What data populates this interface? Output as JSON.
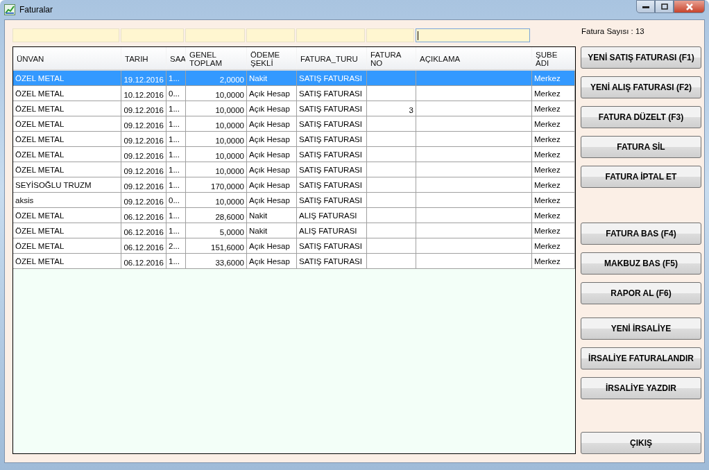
{
  "window": {
    "title": "Faturalar"
  },
  "filters": [
    {
      "focused": false
    },
    {
      "focused": false
    },
    {
      "focused": false
    },
    {
      "focused": false
    },
    {
      "focused": false
    },
    {
      "focused": false
    },
    {
      "focused": true
    }
  ],
  "invoice_count": "Fatura Sayısı : 13",
  "table": {
    "columns": [
      {
        "label": "ÜNVAN"
      },
      {
        "label": "TARIH"
      },
      {
        "label": "SAA"
      },
      {
        "label": "GENEL\nTOPLAM"
      },
      {
        "label": "ÖDEME\nŞEKLİ"
      },
      {
        "label": "FATURA_TURU"
      },
      {
        "label": "FATURA\nNO"
      },
      {
        "label": "AÇIKLAMA"
      },
      {
        "label": "ŞUBE\nADI"
      }
    ],
    "rows": [
      {
        "selected": true,
        "cells": [
          "ÖZEL METAL",
          "19.12.2016",
          "1...",
          "2,0000",
          "Nakit",
          "SATIŞ FATURASI",
          "",
          "",
          "Merkez"
        ]
      },
      {
        "selected": false,
        "cells": [
          "ÖZEL METAL",
          "10.12.2016",
          "0...",
          "10,0000",
          "Açık Hesap",
          "SATIŞ FATURASI",
          "",
          "",
          "Merkez"
        ]
      },
      {
        "selected": false,
        "cells": [
          "ÖZEL METAL",
          "09.12.2016",
          "1...",
          "10,0000",
          "Açık Hesap",
          "SATIŞ FATURASI",
          "3",
          "",
          "Merkez"
        ]
      },
      {
        "selected": false,
        "cells": [
          "ÖZEL METAL",
          "09.12.2016",
          "1...",
          "10,0000",
          "Açık Hesap",
          "SATIŞ FATURASI",
          "",
          "",
          "Merkez"
        ]
      },
      {
        "selected": false,
        "cells": [
          "ÖZEL METAL",
          "09.12.2016",
          "1...",
          "10,0000",
          "Açık Hesap",
          "SATIŞ FATURASI",
          "",
          "",
          "Merkez"
        ]
      },
      {
        "selected": false,
        "cells": [
          "ÖZEL METAL",
          "09.12.2016",
          "1...",
          "10,0000",
          "Açık Hesap",
          "SATIŞ FATURASI",
          "",
          "",
          "Merkez"
        ]
      },
      {
        "selected": false,
        "cells": [
          "ÖZEL METAL",
          "09.12.2016",
          "1...",
          "10,0000",
          "Açık Hesap",
          "SATIŞ FATURASI",
          "",
          "",
          "Merkez"
        ]
      },
      {
        "selected": false,
        "cells": [
          "SEYİSOĞLU TRUZM",
          "09.12.2016",
          "1...",
          "170,0000",
          "Açık Hesap",
          "SATIŞ FATURASI",
          "",
          "",
          "Merkez"
        ]
      },
      {
        "selected": false,
        "cells": [
          "aksis",
          "09.12.2016",
          "0...",
          "10,0000",
          "Açık Hesap",
          "SATIŞ FATURASI",
          "",
          "",
          "Merkez"
        ]
      },
      {
        "selected": false,
        "cells": [
          "ÖZEL METAL",
          "06.12.2016",
          "1...",
          "28,6000",
          "Nakit",
          "ALIŞ FATURASI",
          "",
          "",
          "Merkez"
        ]
      },
      {
        "selected": false,
        "cells": [
          "ÖZEL METAL",
          "06.12.2016",
          "1...",
          "5,0000",
          "Nakit",
          "ALIŞ FATURASI",
          "",
          "",
          "Merkez"
        ]
      },
      {
        "selected": false,
        "cells": [
          "ÖZEL METAL",
          "06.12.2016",
          "2...",
          "151,6000",
          "Açık Hesap",
          "SATIŞ FATURASI",
          "",
          "",
          "Merkez"
        ]
      },
      {
        "selected": false,
        "cells": [
          "ÖZEL METAL",
          "06.12.2016",
          "1...",
          "33,6000",
          "Açık Hesap",
          "SATIŞ FATURASI",
          "",
          "",
          "Merkez"
        ]
      }
    ]
  },
  "button_groups": [
    [
      "YENİ SATIŞ FATURASI (F1)",
      "YENİ ALIŞ FATURASI (F2)",
      "FATURA DÜZELT (F3)",
      "FATURA SİL",
      "FATURA İPTAL ET"
    ],
    [
      "FATURA BAS (F4)",
      "MAKBUZ BAS (F5)",
      "RAPOR AL (F6)"
    ],
    [
      "YENİ İRSALİYE",
      "İRSALİYE FATURALANDIR",
      "İRSALİYE YAZDIR"
    ],
    [
      "ÇIKIŞ"
    ]
  ]
}
